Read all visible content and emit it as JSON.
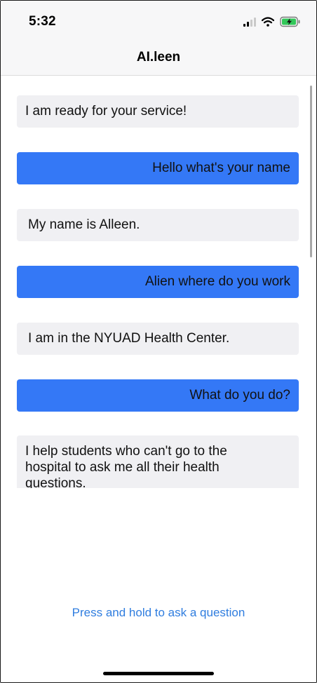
{
  "status_bar": {
    "time": "5:32",
    "icons": [
      "cellular-signal-icon",
      "wifi-icon",
      "battery-charging-icon"
    ],
    "battery_color": "#32c759"
  },
  "nav": {
    "title": "AI.leen"
  },
  "messages": [
    {
      "sender": "bot",
      "text": "I am ready for your service!"
    },
    {
      "sender": "user",
      "text": "Hello what's your name"
    },
    {
      "sender": "bot",
      "text": "My name is Alleen."
    },
    {
      "sender": "user",
      "text": "Alien where do you work"
    },
    {
      "sender": "bot",
      "text": "I am in the NYUAD Health Center."
    },
    {
      "sender": "user",
      "text": "What do you do?"
    },
    {
      "sender": "bot",
      "text": "I help students who can't go to the hospital to ask me all their health questions."
    }
  ],
  "action": {
    "label": "Press and hold to ask a question"
  },
  "colors": {
    "user_bubble": "#3478f6",
    "bot_bubble": "#f0f0f3",
    "link": "#2f7ddf"
  }
}
